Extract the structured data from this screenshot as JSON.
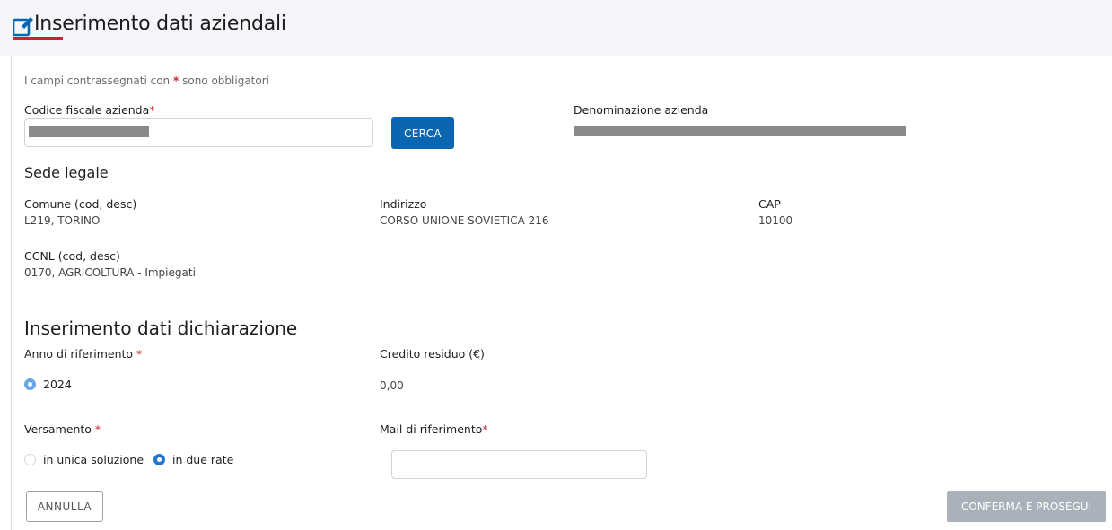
{
  "page": {
    "title": "Inserimento dati aziendali",
    "required_note_prefix": "I campi contrassegnati con",
    "required_note_star": "*",
    "required_note_suffix": "sono obbligatori"
  },
  "azienda": {
    "codice_fiscale_label": "Codice fiscale azienda",
    "codice_fiscale_value": "",
    "cerca_button": "CERCA",
    "denominazione_label": "Denominazione azienda",
    "denominazione_value": ""
  },
  "sede_legale": {
    "heading": "Sede legale",
    "comune_label": "Comune (cod, desc)",
    "comune_value": "L219, TORINO",
    "indirizzo_label": "Indirizzo",
    "indirizzo_value": "CORSO UNIONE SOVIETICA 216",
    "cap_label": "CAP",
    "cap_value": "10100",
    "ccnl_label": "CCNL (cod, desc)",
    "ccnl_value": "0170, AGRICOLTURA - Impiegati"
  },
  "dichiarazione": {
    "heading": "Inserimento dati dichiarazione",
    "anno_label": "Anno di riferimento",
    "anno_option": "2024",
    "credito_label": "Credito residuo (€)",
    "credito_value": "0,00",
    "versamento_label": "Versamento",
    "versamento_options": [
      "in unica soluzione",
      "in due rate"
    ],
    "versamento_selected": "in due rate",
    "mail_label": "Mail di riferimento",
    "mail_value": ""
  },
  "actions": {
    "annulla": "ANNULLA",
    "conferma": "CONFERMA E PROSEGUI"
  },
  "colors": {
    "primary": "#0b66b2",
    "required": "#c3262f",
    "disabled": "#a9b2ba",
    "radio_selected": "#1f77d0"
  },
  "icons": {
    "title": "edit-icon"
  }
}
